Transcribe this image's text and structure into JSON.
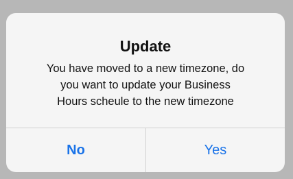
{
  "dialog": {
    "title": "Update",
    "message_lines": [
      "You have moved to a new timezone, do",
      "you want to update your Business",
      "Hours scheule to the new timezone"
    ],
    "buttons": {
      "no_label": "No",
      "yes_label": "Yes"
    }
  },
  "colors": {
    "backdrop": "#b7b7b7",
    "dialog_bg": "#f5f5f5",
    "button_text": "#1a73e8",
    "divider": "#d0d0d0"
  }
}
